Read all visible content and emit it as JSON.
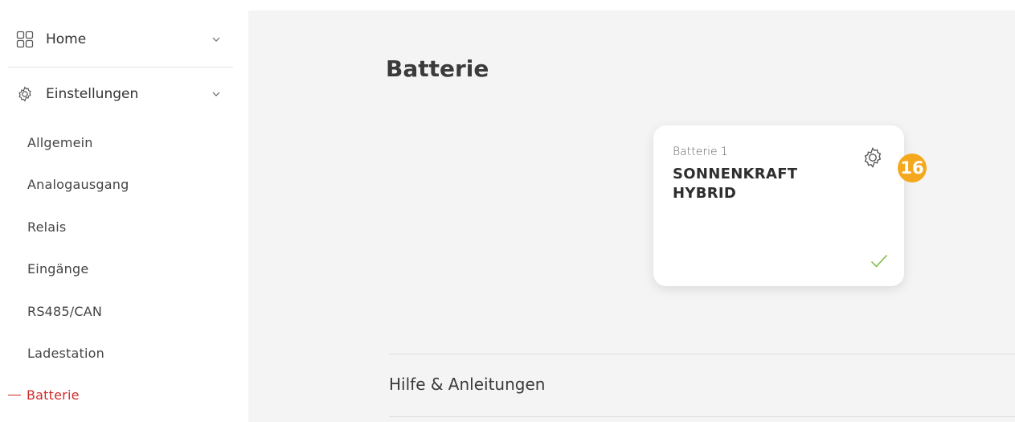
{
  "sidebar": {
    "home_label": "Home",
    "settings_label": "Einstellungen",
    "sub_items": [
      "Allgemein",
      "Analogausgang",
      "Relais",
      "Eingänge",
      "RS485/CAN",
      "Ladestation"
    ],
    "active_item": "Batterie",
    "active_color": "#d02a2a"
  },
  "main": {
    "title": "Batterie",
    "card": {
      "subtitle": "Batterie 1",
      "name": "SONNENKRAFT HYBRID",
      "settings_icon": "gear-icon",
      "status_icon": "check-icon",
      "status_color": "#7cba3f"
    },
    "badge": {
      "number": "16",
      "color": "#f4a81d"
    },
    "help_label": "Hilfe & Anleitungen"
  }
}
